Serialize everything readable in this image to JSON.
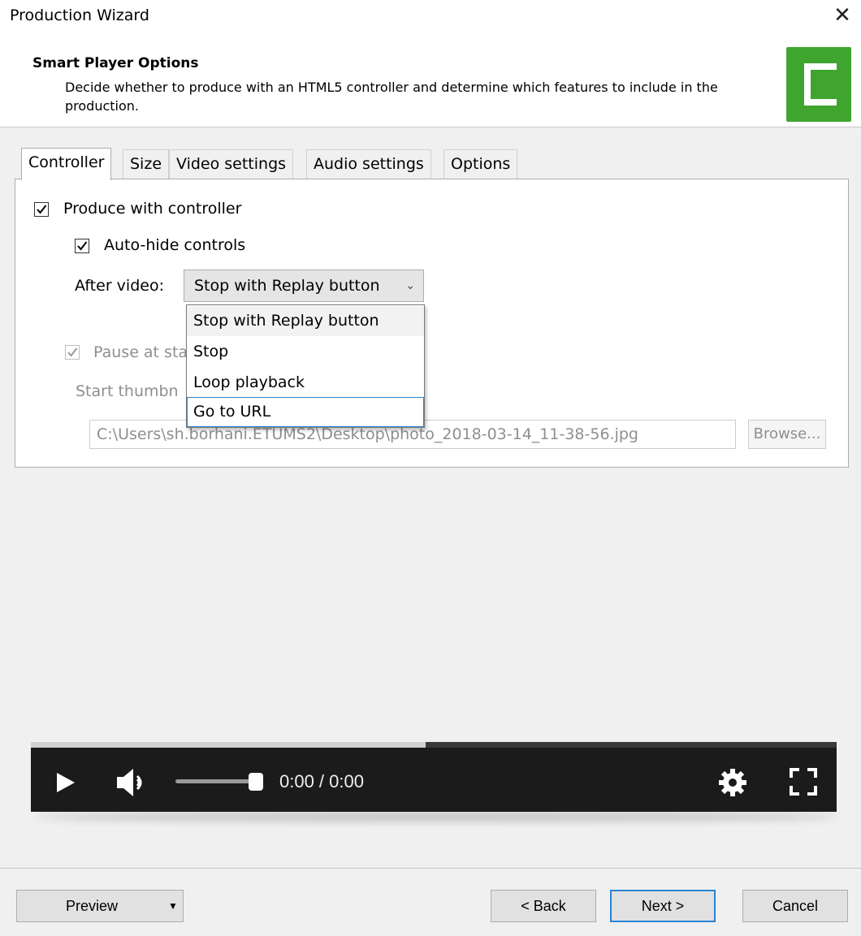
{
  "window": {
    "title": "Production Wizard",
    "close_glyph": "✕"
  },
  "header": {
    "title": "Smart Player Options",
    "description": "Decide whether to produce with an HTML5 controller and determine which features to include in the production.",
    "logo_icon": "camtasia-logo-icon",
    "logo_color": "#3fa52e"
  },
  "tabs": [
    {
      "label": "Controller",
      "active": true
    },
    {
      "label": "Size",
      "active": false
    },
    {
      "label": "Video settings",
      "active": false
    },
    {
      "label": "Audio settings",
      "active": false
    },
    {
      "label": "Options",
      "active": false
    }
  ],
  "controller": {
    "produce_with_controller": {
      "label": "Produce with controller",
      "checked": true
    },
    "auto_hide_controls": {
      "label": "Auto-hide controls",
      "checked": true
    },
    "after_video": {
      "label": "After video:",
      "selected": "Stop with Replay button",
      "options": [
        "Stop with Replay button",
        "Stop",
        "Loop playback",
        "Go to URL"
      ],
      "focused_option": "Go to URL"
    },
    "pause_at_start": {
      "label": "Pause at sta",
      "checked": true,
      "disabled": true
    },
    "start_thumbnail": {
      "label": "Start thumbn",
      "path": "C:\\Users\\sh.borhani.ETUMS2\\Desktop\\photo_2018-03-14_11-38-56.jpg",
      "browse_label": "Browse..."
    }
  },
  "player": {
    "time": "0:00 / 0:00",
    "progress": 0.49,
    "volume": 1.0,
    "background": "#1b1b1b"
  },
  "footer": {
    "preview_label": "Preview",
    "preview_mnemonic": "v",
    "back_label": "< Back",
    "next_label": "Next >",
    "cancel_label": "Cancel"
  },
  "colors": {
    "accent": "#2a84d2"
  }
}
